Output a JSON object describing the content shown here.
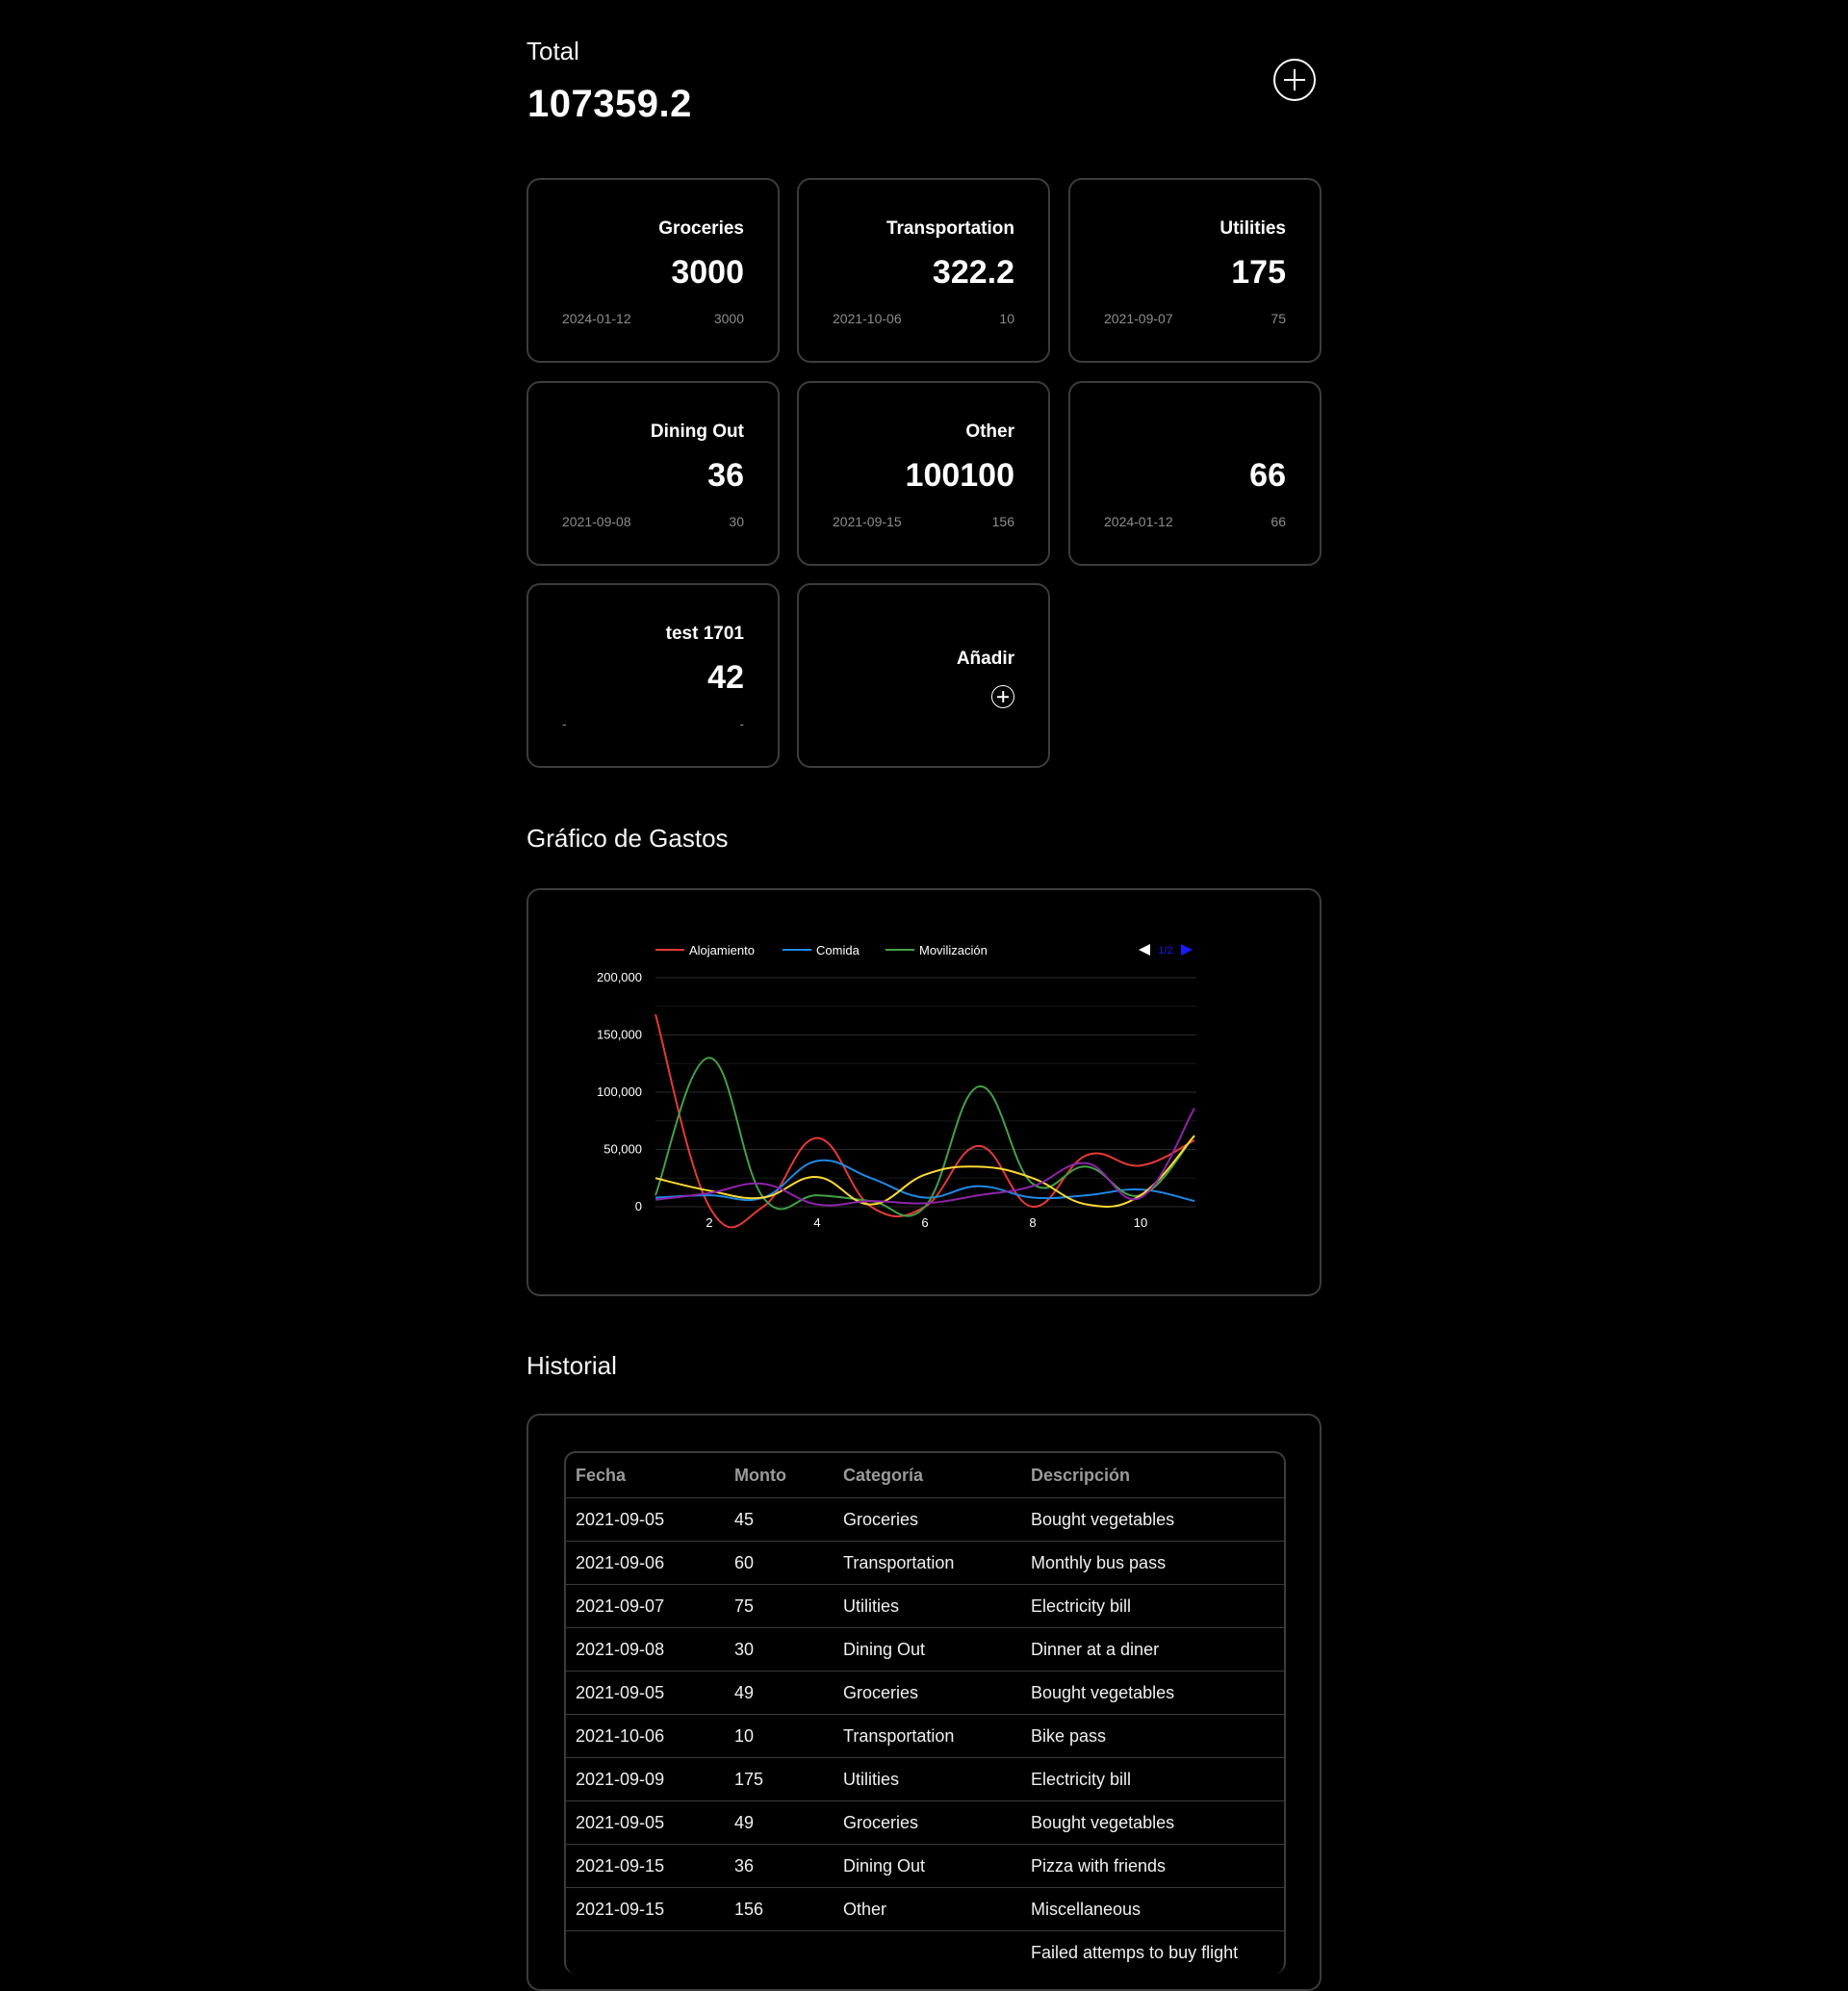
{
  "header": {
    "total_label": "Total",
    "total_value": "107359.2"
  },
  "cards": [
    {
      "title": "Groceries",
      "amount": "3000",
      "date": "2024-01-12",
      "last": "3000"
    },
    {
      "title": "Transportation",
      "amount": "322.2",
      "date": "2021-10-06",
      "last": "10"
    },
    {
      "title": "Utilities",
      "amount": "175",
      "date": "2021-09-07",
      "last": "75"
    },
    {
      "title": "Dining Out",
      "amount": "36",
      "date": "2021-09-08",
      "last": "30"
    },
    {
      "title": "Other",
      "amount": "100100",
      "date": "2021-09-15",
      "last": "156"
    },
    {
      "title": "",
      "amount": "66",
      "date": "2024-01-12",
      "last": "66"
    },
    {
      "title": "test 1701",
      "amount": "42",
      "date": "-",
      "last": "-"
    }
  ],
  "add_card": {
    "label": "Añadir"
  },
  "chart_section": {
    "title": "Gráfico de Gastos"
  },
  "chart_data": {
    "type": "line",
    "x": [
      1,
      2,
      3,
      4,
      5,
      6,
      7,
      8,
      9,
      10,
      11
    ],
    "xticks": [
      2,
      4,
      6,
      8,
      10
    ],
    "yticks": [
      "0",
      "50,000",
      "100,000",
      "150,000",
      "200,000"
    ],
    "ylim": [
      0,
      200000
    ],
    "legend_placement": "top",
    "pager": "1/2",
    "series": [
      {
        "name": "Alojamiento",
        "color": "#e53935",
        "values": [
          168000,
          0,
          0,
          60000,
          0,
          0,
          53000,
          0,
          45000,
          36000,
          58000
        ]
      },
      {
        "name": "Comida",
        "color": "#1e88e5",
        "values": [
          8000,
          10000,
          8000,
          40000,
          25000,
          8000,
          18000,
          8000,
          10000,
          15000,
          5000
        ]
      },
      {
        "name": "Movilización",
        "color": "#43a047",
        "values": [
          10000,
          130000,
          8000,
          10000,
          5000,
          0,
          105000,
          20000,
          35000,
          10000,
          62000
        ]
      },
      {
        "name": "",
        "color": "#fdd835",
        "values": [
          25000,
          14000,
          8000,
          26000,
          2000,
          28000,
          35000,
          25000,
          2000,
          10000,
          62000
        ]
      },
      {
        "name": "",
        "color": "#8e24aa",
        "values": [
          6000,
          12000,
          20000,
          2000,
          5000,
          3000,
          10000,
          18000,
          38000,
          8000,
          86000
        ]
      }
    ]
  },
  "history_section": {
    "title": "Historial"
  },
  "table": {
    "headers": [
      "Fecha",
      "Monto",
      "Categoría",
      "Descripción"
    ],
    "rows": [
      [
        "2021-09-05",
        "45",
        "Groceries",
        "Bought vegetables"
      ],
      [
        "2021-09-06",
        "60",
        "Transportation",
        "Monthly bus pass"
      ],
      [
        "2021-09-07",
        "75",
        "Utilities",
        "Electricity bill"
      ],
      [
        "2021-09-08",
        "30",
        "Dining Out",
        "Dinner at a diner"
      ],
      [
        "2021-09-05",
        "49",
        "Groceries",
        "Bought vegetables"
      ],
      [
        "2021-10-06",
        "10",
        "Transportation",
        "Bike pass"
      ],
      [
        "2021-09-09",
        "175",
        "Utilities",
        "Electricity bill"
      ],
      [
        "2021-09-05",
        "49",
        "Groceries",
        "Bought vegetables"
      ],
      [
        "2021-09-15",
        "36",
        "Dining Out",
        "Pizza with friends"
      ],
      [
        "2021-09-15",
        "156",
        "Other",
        "Miscellaneous"
      ],
      [
        "",
        "",
        "",
        "Failed attemps to buy flight"
      ]
    ]
  }
}
